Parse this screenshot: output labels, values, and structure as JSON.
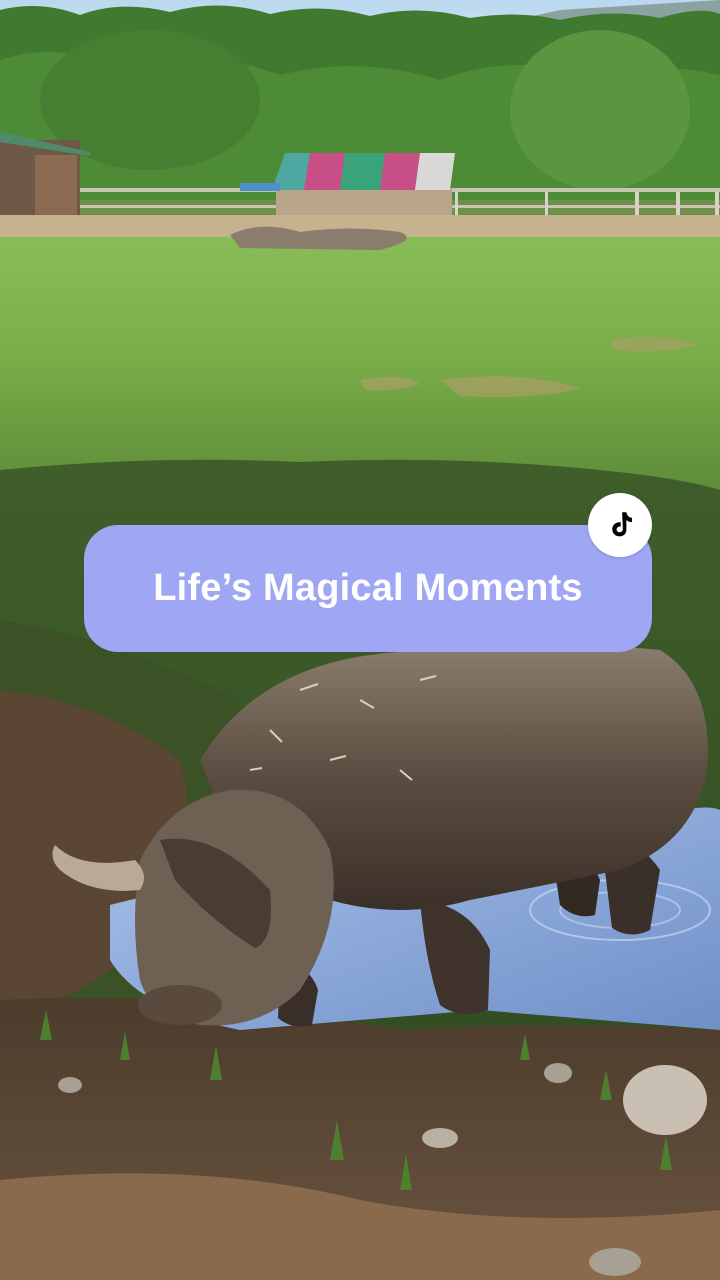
{
  "caption": {
    "text": "Life’s Magical Moments",
    "background_color": "#9fa6f4",
    "text_color": "#ffffff"
  },
  "badge": {
    "icon": "tiktok-logo-icon",
    "background_color": "#ffffff"
  },
  "scene": {
    "description_icon": "pig-in-mud-puddle-photo"
  }
}
